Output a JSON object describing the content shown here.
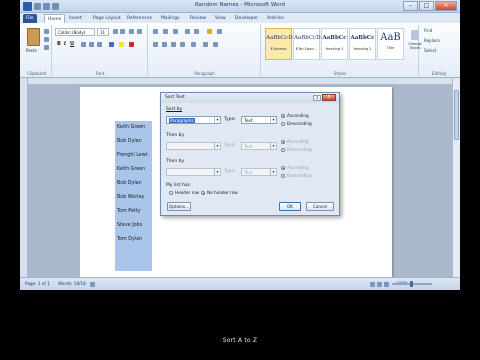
{
  "window": {
    "title": "Random Names - Microsoft Word"
  },
  "tabs": [
    "File",
    "Home",
    "Insert",
    "Page Layout",
    "References",
    "Mailings",
    "Review",
    "View",
    "Developer",
    "Add-Ins"
  ],
  "active_tab": "Home",
  "ribbon": {
    "clipboard": {
      "paste": "Paste",
      "label": "Clipboard"
    },
    "font": {
      "name": "Calibri (Body)",
      "size": "11",
      "label": "Font"
    },
    "paragraph": {
      "label": "Paragraph"
    },
    "styles": {
      "label": "Styles",
      "items": [
        {
          "sample": "AaBbCcDc",
          "name": "¶ Normal"
        },
        {
          "sample": "AaBbCcDc",
          "name": "¶ No Spaci..."
        },
        {
          "sample": "AaBbCc",
          "name": "Heading 1"
        },
        {
          "sample": "AaBbCc",
          "name": "Heading 2"
        },
        {
          "sample": "AaB",
          "name": "Title"
        }
      ],
      "change_styles": "Change Styles"
    },
    "editing": {
      "label": "Editing",
      "find": "Find",
      "replace": "Replace",
      "select": "Select"
    }
  },
  "document": {
    "names": [
      "Keith Green",
      "Bob Dylan",
      "Frenghl Lewt",
      "Keith Green",
      "Bob Dylan",
      "Bob Worley",
      "Tom Petty",
      "Steve Jobs",
      "Tom Dylan"
    ]
  },
  "dialog": {
    "title": "Sort Text",
    "help": "?",
    "close": "X",
    "sort_by_label": "Sort by",
    "sort_by_value": "Paragraphs",
    "type_label": "Type:",
    "type_value": "Text",
    "then_by_1": "Then by",
    "then_by_2": "Then by",
    "ascending": "Ascending",
    "descending": "Descending",
    "my_list_has": "My list has",
    "header_row": "Header row",
    "no_header_row": "No header row",
    "options": "Options...",
    "ok": "OK",
    "cancel": "Cancel"
  },
  "status": {
    "page": "Page: 1 of 1",
    "words": "Words: 18/18",
    "zoom": "100%"
  },
  "caption": "Sort A to Z"
}
